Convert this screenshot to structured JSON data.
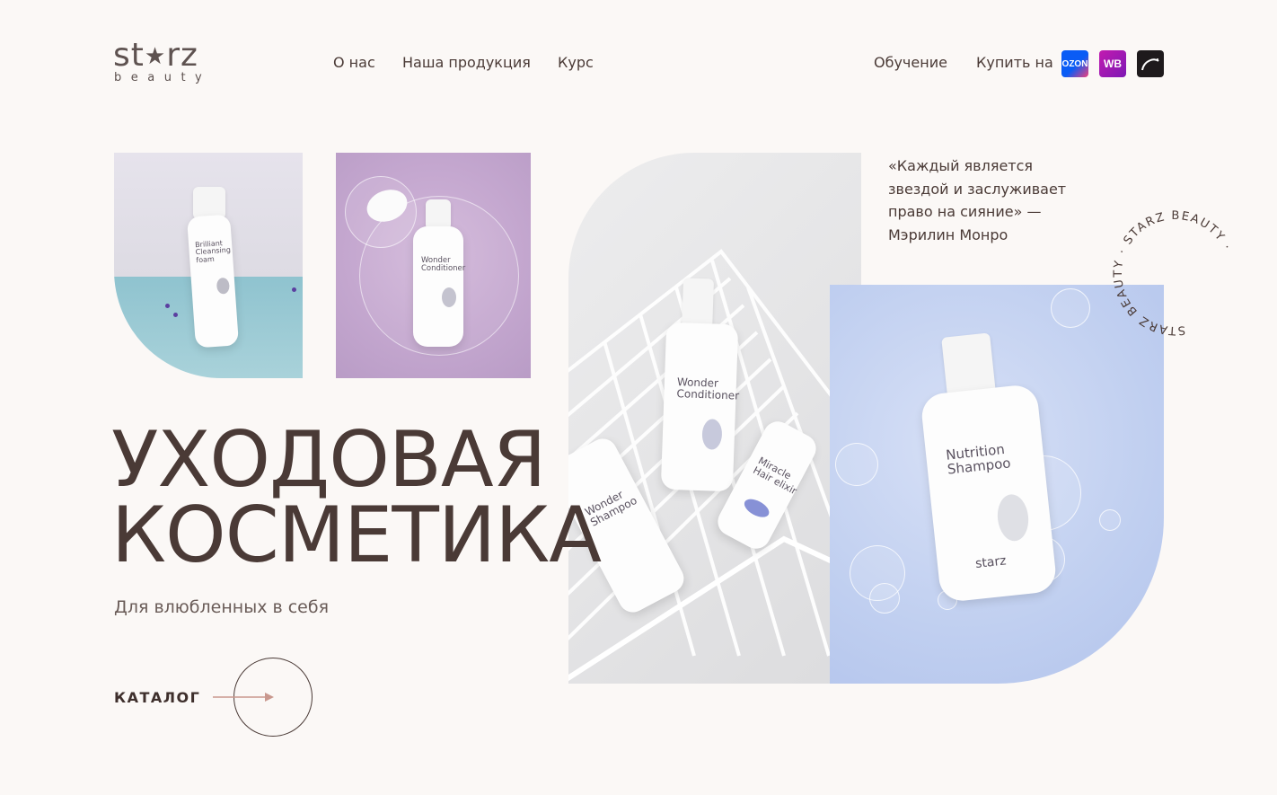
{
  "brand": {
    "word": "starz",
    "sub": "beauty"
  },
  "nav": {
    "about": "О нас",
    "products": "Наша продукция",
    "course": "Курс",
    "training": "Обучение",
    "buy_on": "Купить на"
  },
  "marketplaces": [
    {
      "name": "ozon",
      "label": "OZON",
      "color": "#0a5cf5"
    },
    {
      "name": "wildberries",
      "label": "WB",
      "color": "#a21ab6"
    },
    {
      "name": "zolotoe-yabloko",
      "label": "",
      "color": "#1e1a1c"
    }
  ],
  "quote": {
    "text": "«Каждый является звездой и заслуживает право на сияние» — Мэрилин Монро"
  },
  "badge": {
    "text": "STARZ BEAUTY · STARZ BEAUTY · "
  },
  "hero": {
    "title_line1": "УХОДОВАЯ",
    "title_line2": "КОСМЕТИКА",
    "subtitle": "Для влюбленных в себя",
    "catalog": "КАТАЛОГ"
  },
  "products": {
    "p1": {
      "line1": "Brilliant",
      "line2": "Cleansing",
      "line3": "foam"
    },
    "p2": {
      "line1": "Wonder",
      "line2": "Conditioner"
    },
    "p3a": {
      "line1": "Wonder",
      "line2": "Conditioner"
    },
    "p3b": {
      "line1": "Wonder",
      "line2": "Shampoo"
    },
    "p3c": {
      "line1": "Miracle",
      "line2": "Hair elixir"
    },
    "p4": {
      "line1": "Nutrition",
      "line2": "Shampoo"
    },
    "brand_mark": "starz"
  },
  "colors": {
    "background": "#fbf8f6",
    "text": "#4a3a36",
    "arrow": "#c9988e"
  }
}
